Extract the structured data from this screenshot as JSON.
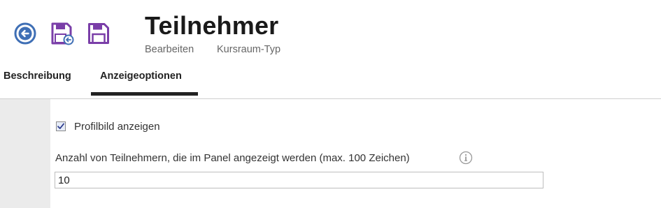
{
  "toolbar": {
    "back_icon": "arrow-left-circle-icon",
    "save_close_icon": "save-and-close-icon",
    "save_icon": "floppy-disk-icon",
    "back_color": "#3f6fb5",
    "save_color": "#7a3ea8"
  },
  "header": {
    "title": "Teilnehmer",
    "subtitles": [
      "Bearbeiten",
      "Kursraum-Typ"
    ]
  },
  "tabs": [
    {
      "label": "Beschreibung",
      "active": false
    },
    {
      "label": "Anzeigeoptionen",
      "active": true
    }
  ],
  "form": {
    "show_profile_picture": {
      "label": "Profilbild anzeigen",
      "checked": true
    },
    "participant_count": {
      "label": "Anzahl von Teilnehmern, die im Panel angezeigt werden (max. 100 Zeichen)",
      "value": "10",
      "info_icon": "info-circle-icon"
    }
  }
}
